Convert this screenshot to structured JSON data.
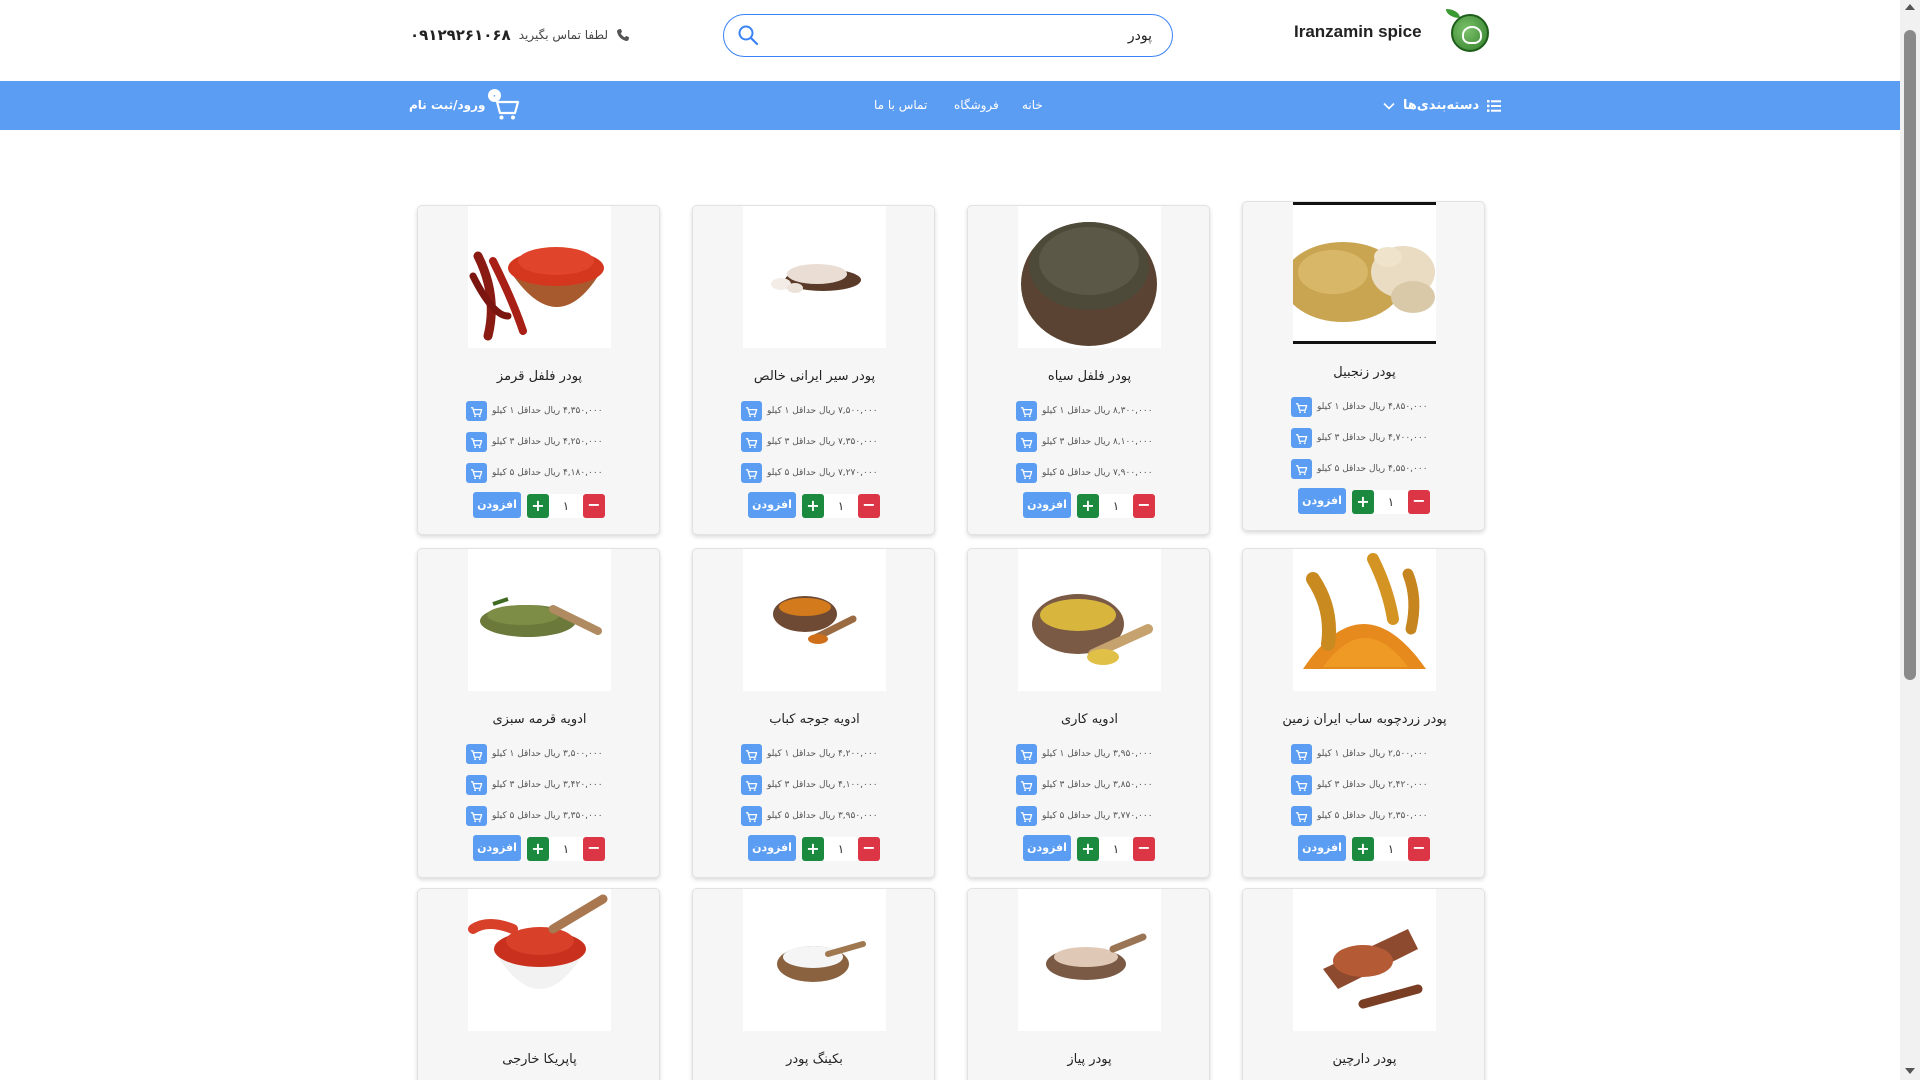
{
  "header": {
    "brand": "Iranzamin spice",
    "search_value": "پودر",
    "contact_label": "لطفا تماس بگیرید",
    "contact_number": "۰۹۱۲۹۲۶۱۰۶۸"
  },
  "nav": {
    "categories": "دسته‌بندی‌ها",
    "home": "خانه",
    "shop": "فروشگاه",
    "contact": "تماس با ما",
    "cart_count": "۰",
    "login": "ورود/ثبت نام"
  },
  "colors": {
    "accent": "#5b9df3",
    "add": "#1b8a3e",
    "remove": "#dc3545"
  },
  "products": [
    {
      "name": "پودر زنجبیل",
      "image": "ginger-powder-photo",
      "prices": [
        "۴,۸۵۰,۰۰۰ ریال  حداقل ۱ کیلو",
        "۴,۷۰۰,۰۰۰ ریال  حداقل ۳ کیلو",
        "۴,۵۵۰,۰۰۰ ریال  حداقل ۵ کیلو"
      ],
      "qty": "۱",
      "add_label": "افزودن"
    },
    {
      "name": "پودر فلفل سیاه",
      "image": "black-pepper-powder-photo",
      "prices": [
        "۸,۳۰۰,۰۰۰ ریال  حداقل ۱ کیلو",
        "۸,۱۰۰,۰۰۰ ریال  حداقل ۳ کیلو",
        "۷,۹۰۰,۰۰۰ ریال  حداقل ۵ کیلو"
      ],
      "qty": "۱",
      "add_label": "افزودن"
    },
    {
      "name": "پودر سیر ایرانی خالص",
      "image": "garlic-powder-photo",
      "prices": [
        "۷,۵۰۰,۰۰۰ ریال  حداقل ۱ کیلو",
        "۷,۳۵۰,۰۰۰ ریال  حداقل ۳ کیلو",
        "۷,۲۷۰,۰۰۰ ریال  حداقل ۵ کیلو"
      ],
      "qty": "۱",
      "add_label": "افزودن"
    },
    {
      "name": "پودر فلفل قرمز",
      "image": "red-pepper-powder-photo",
      "prices": [
        "۴,۳۵۰,۰۰۰ ریال  حداقل ۱ کیلو",
        "۴,۲۵۰,۰۰۰ ریال  حداقل ۳ کیلو",
        "۴,۱۸۰,۰۰۰ ریال  حداقل ۵ کیلو"
      ],
      "qty": "۱",
      "add_label": "افزودن"
    },
    {
      "name": "پودر زردچوبه ساب ایران زمین",
      "image": "turmeric-powder-photo",
      "prices": [
        "۲,۵۰۰,۰۰۰ ریال  حداقل ۱ کیلو",
        "۲,۴۲۰,۰۰۰ ریال  حداقل ۳ کیلو",
        "۲,۳۵۰,۰۰۰ ریال  حداقل ۵ کیلو"
      ],
      "qty": "۱",
      "add_label": "افزودن"
    },
    {
      "name": "ادویه کاری",
      "image": "curry-powder-photo",
      "prices": [
        "۳,۹۵۰,۰۰۰ ریال  حداقل ۱ کیلو",
        "۳,۸۵۰,۰۰۰ ریال  حداقل ۳ کیلو",
        "۳,۷۷۰,۰۰۰ ریال  حداقل ۵ کیلو"
      ],
      "qty": "۱",
      "add_label": "افزودن"
    },
    {
      "name": "ادویه جوجه کباب",
      "image": "kebab-spice-photo",
      "prices": [
        "۴,۲۰۰,۰۰۰ ریال  حداقل ۱ کیلو",
        "۴,۱۰۰,۰۰۰ ریال  حداقل ۳ کیلو",
        "۳,۹۵۰,۰۰۰ ریال  حداقل ۵ کیلو"
      ],
      "qty": "۱",
      "add_label": "افزودن"
    },
    {
      "name": "ادویه قرمه سبزی",
      "image": "ghormeh-sabzi-spice-photo",
      "prices": [
        "۳,۵۰۰,۰۰۰ ریال  حداقل ۱ کیلو",
        "۳,۴۲۰,۰۰۰ ریال  حداقل ۳ کیلو",
        "۳,۳۵۰,۰۰۰ ریال  حداقل ۵ کیلو"
      ],
      "qty": "۱",
      "add_label": "افزودن"
    },
    {
      "name": "پودر دارچین",
      "image": "cinnamon-powder-photo",
      "prices": [],
      "qty": "",
      "add_label": ""
    },
    {
      "name": "پودر پیاز",
      "image": "onion-powder-photo",
      "prices": [],
      "qty": "",
      "add_label": ""
    },
    {
      "name": "بکینگ پودر",
      "image": "baking-powder-photo",
      "prices": [],
      "qty": "",
      "add_label": ""
    },
    {
      "name": "پاپریکا خارجی",
      "image": "paprika-photo",
      "prices": [],
      "qty": "",
      "add_label": ""
    }
  ]
}
